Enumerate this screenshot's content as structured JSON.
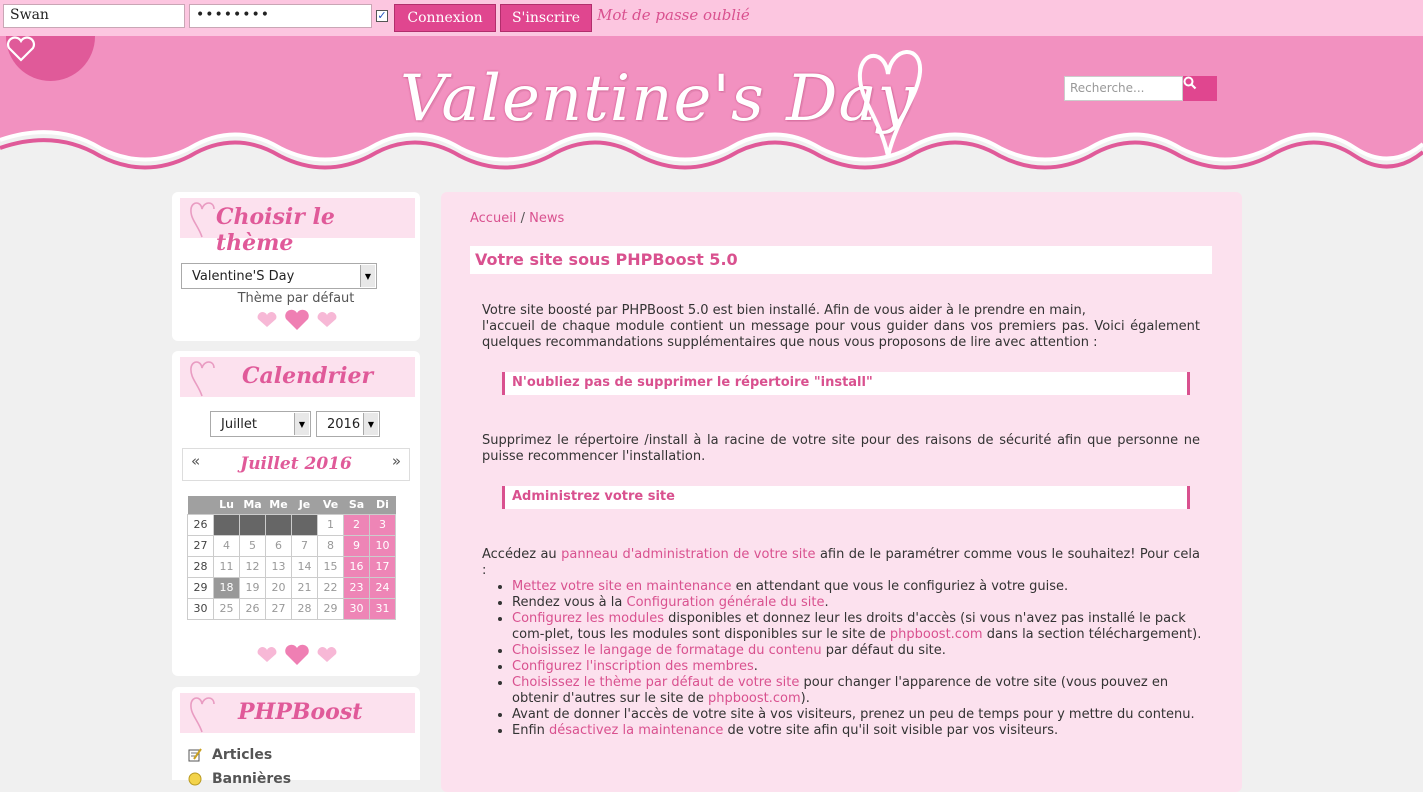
{
  "login": {
    "username_value": "Swan",
    "password_value": "••••••••",
    "login_button": "Connexion",
    "register_button": "S'inscrire",
    "forgot_link": "Mot de passe oublié"
  },
  "header": {
    "site_title": "Valentine's Day",
    "search_placeholder": "Recherche..."
  },
  "theme_block": {
    "title": "Choisir le thème",
    "selected_theme": "Valentine'S Day",
    "default_label": "Thème par défaut"
  },
  "calendar_block": {
    "title": "Calendrier",
    "month_select": "Juillet",
    "year_select": "2016",
    "month_title": "Juillet 2016",
    "prev": "«",
    "next": "»",
    "weekdays": [
      "Lu",
      "Ma",
      "Me",
      "Je",
      "Ve",
      "Sa",
      "Di"
    ],
    "weeks": [
      {
        "week": "26",
        "days": [
          "",
          "",
          "",
          "",
          "1",
          "2",
          "3"
        ]
      },
      {
        "week": "27",
        "days": [
          "4",
          "5",
          "6",
          "7",
          "8",
          "9",
          "10"
        ]
      },
      {
        "week": "28",
        "days": [
          "11",
          "12",
          "13",
          "14",
          "15",
          "16",
          "17"
        ]
      },
      {
        "week": "29",
        "days": [
          "18",
          "19",
          "20",
          "21",
          "22",
          "23",
          "24"
        ]
      },
      {
        "week": "30",
        "days": [
          "25",
          "26",
          "27",
          "28",
          "29",
          "30",
          "31"
        ]
      }
    ],
    "today": "18"
  },
  "phpboost_block": {
    "title": "PHPBoost",
    "items": [
      "Articles",
      "Bannières"
    ]
  },
  "main": {
    "breadcrumb": [
      "Accueil",
      "News"
    ],
    "breadcrumb_sep": "/",
    "article_title": "Votre site sous PHPBoost 5.0",
    "intro_line1": "Votre site boosté par PHPBoost 5.0 est bien installé. Afin de vous aider à le prendre en main,",
    "intro_line2": "l'accueil de chaque module contient un message pour vous guider dans vos premiers pas. Voici également quelques recommandations supplémentaires que nous vous proposons de lire avec attention :",
    "alert1": "N'oubliez pas de supprimer le répertoire \"install\"",
    "para2": "Supprimez le répertoire /install à la racine de votre site pour des raisons de sécurité afin que personne ne puisse recommencer l'installation.",
    "alert2": "Administrez votre site",
    "para3_pre": "Accédez au ",
    "para3_link": "panneau d'administration de votre site",
    "para3_post": " afin de le paramétrer comme vous le souhaitez! Pour cela :",
    "list": [
      {
        "pre": "",
        "link": "Mettez votre site en maintenance",
        "post": " en attendant que vous le configuriez à votre guise."
      },
      {
        "pre": "Rendez vous à la ",
        "link": "Configuration générale du site",
        "post": "."
      },
      {
        "pre": "",
        "link": "Configurez les modules",
        "post": " disponibles et donnez leur les droits d'accès (si vous n'avez pas installé le pack com-plet, tous les modules sont disponibles sur le site de ",
        "link2": "phpboost.com",
        "post2": " dans la section téléchargement)."
      },
      {
        "pre": "",
        "link": "Choisissez le langage de formatage du contenu",
        "post": " par défaut du site."
      },
      {
        "pre": "",
        "link": "Configurez l'inscription des membres",
        "post": "."
      },
      {
        "pre": "",
        "link": "Choisissez le thème par défaut de votre site",
        "post": " pour changer l'apparence de votre site (vous pouvez en obtenir d'autres sur le site de ",
        "link2": "phpboost.com",
        "post2": ")."
      },
      {
        "pre": "Avant de donner l'accès de votre site à vos visiteurs, prenez un peu de temps pour y mettre du contenu.",
        "link": "",
        "post": ""
      },
      {
        "pre": "Enfin ",
        "link": "désactivez la maintenance",
        "post": " de votre site afin qu'il soit visible par vos visiteurs."
      }
    ]
  },
  "colors": {
    "accent": "#e0468f",
    "link": "#d9518f",
    "header_pink": "#f291c0",
    "topbar": "#fcc6e0"
  }
}
